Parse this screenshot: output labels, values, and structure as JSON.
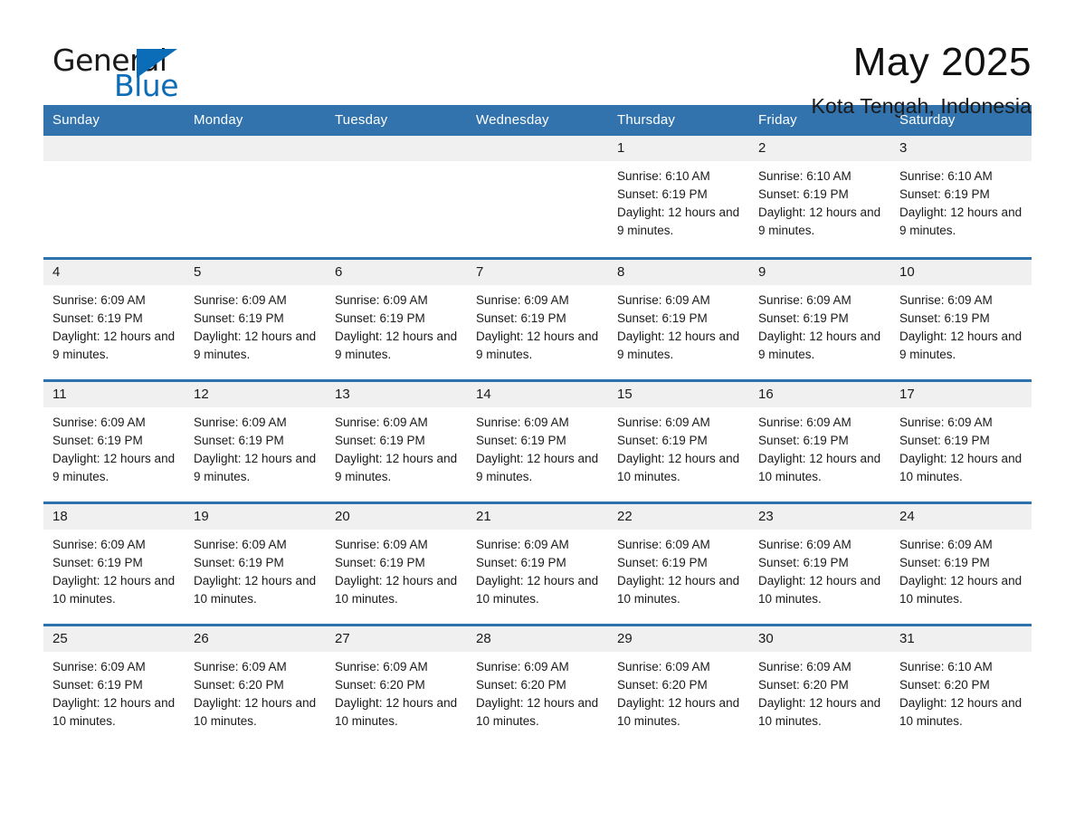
{
  "brand": {
    "name_part1": "General",
    "name_part2": "Blue",
    "triangle_color": "#0b6cb8",
    "accent_color": "#3273ad"
  },
  "header": {
    "month_title": "May 2025",
    "location": "Kota Tengah, Indonesia"
  },
  "calendar": {
    "weekday_headers": [
      "Sunday",
      "Monday",
      "Tuesday",
      "Wednesday",
      "Thursday",
      "Friday",
      "Saturday"
    ],
    "weeks": [
      [
        {
          "day": "",
          "empty": true
        },
        {
          "day": "",
          "empty": true
        },
        {
          "day": "",
          "empty": true
        },
        {
          "day": "",
          "empty": true
        },
        {
          "day": "1",
          "sunrise": "Sunrise: 6:10 AM",
          "sunset": "Sunset: 6:19 PM",
          "daylight": "Daylight: 12 hours and 9 minutes."
        },
        {
          "day": "2",
          "sunrise": "Sunrise: 6:10 AM",
          "sunset": "Sunset: 6:19 PM",
          "daylight": "Daylight: 12 hours and 9 minutes."
        },
        {
          "day": "3",
          "sunrise": "Sunrise: 6:10 AM",
          "sunset": "Sunset: 6:19 PM",
          "daylight": "Daylight: 12 hours and 9 minutes."
        }
      ],
      [
        {
          "day": "4",
          "sunrise": "Sunrise: 6:09 AM",
          "sunset": "Sunset: 6:19 PM",
          "daylight": "Daylight: 12 hours and 9 minutes."
        },
        {
          "day": "5",
          "sunrise": "Sunrise: 6:09 AM",
          "sunset": "Sunset: 6:19 PM",
          "daylight": "Daylight: 12 hours and 9 minutes."
        },
        {
          "day": "6",
          "sunrise": "Sunrise: 6:09 AM",
          "sunset": "Sunset: 6:19 PM",
          "daylight": "Daylight: 12 hours and 9 minutes."
        },
        {
          "day": "7",
          "sunrise": "Sunrise: 6:09 AM",
          "sunset": "Sunset: 6:19 PM",
          "daylight": "Daylight: 12 hours and 9 minutes."
        },
        {
          "day": "8",
          "sunrise": "Sunrise: 6:09 AM",
          "sunset": "Sunset: 6:19 PM",
          "daylight": "Daylight: 12 hours and 9 minutes."
        },
        {
          "day": "9",
          "sunrise": "Sunrise: 6:09 AM",
          "sunset": "Sunset: 6:19 PM",
          "daylight": "Daylight: 12 hours and 9 minutes."
        },
        {
          "day": "10",
          "sunrise": "Sunrise: 6:09 AM",
          "sunset": "Sunset: 6:19 PM",
          "daylight": "Daylight: 12 hours and 9 minutes."
        }
      ],
      [
        {
          "day": "11",
          "sunrise": "Sunrise: 6:09 AM",
          "sunset": "Sunset: 6:19 PM",
          "daylight": "Daylight: 12 hours and 9 minutes."
        },
        {
          "day": "12",
          "sunrise": "Sunrise: 6:09 AM",
          "sunset": "Sunset: 6:19 PM",
          "daylight": "Daylight: 12 hours and 9 minutes."
        },
        {
          "day": "13",
          "sunrise": "Sunrise: 6:09 AM",
          "sunset": "Sunset: 6:19 PM",
          "daylight": "Daylight: 12 hours and 9 minutes."
        },
        {
          "day": "14",
          "sunrise": "Sunrise: 6:09 AM",
          "sunset": "Sunset: 6:19 PM",
          "daylight": "Daylight: 12 hours and 9 minutes."
        },
        {
          "day": "15",
          "sunrise": "Sunrise: 6:09 AM",
          "sunset": "Sunset: 6:19 PM",
          "daylight": "Daylight: 12 hours and 10 minutes."
        },
        {
          "day": "16",
          "sunrise": "Sunrise: 6:09 AM",
          "sunset": "Sunset: 6:19 PM",
          "daylight": "Daylight: 12 hours and 10 minutes."
        },
        {
          "day": "17",
          "sunrise": "Sunrise: 6:09 AM",
          "sunset": "Sunset: 6:19 PM",
          "daylight": "Daylight: 12 hours and 10 minutes."
        }
      ],
      [
        {
          "day": "18",
          "sunrise": "Sunrise: 6:09 AM",
          "sunset": "Sunset: 6:19 PM",
          "daylight": "Daylight: 12 hours and 10 minutes."
        },
        {
          "day": "19",
          "sunrise": "Sunrise: 6:09 AM",
          "sunset": "Sunset: 6:19 PM",
          "daylight": "Daylight: 12 hours and 10 minutes."
        },
        {
          "day": "20",
          "sunrise": "Sunrise: 6:09 AM",
          "sunset": "Sunset: 6:19 PM",
          "daylight": "Daylight: 12 hours and 10 minutes."
        },
        {
          "day": "21",
          "sunrise": "Sunrise: 6:09 AM",
          "sunset": "Sunset: 6:19 PM",
          "daylight": "Daylight: 12 hours and 10 minutes."
        },
        {
          "day": "22",
          "sunrise": "Sunrise: 6:09 AM",
          "sunset": "Sunset: 6:19 PM",
          "daylight": "Daylight: 12 hours and 10 minutes."
        },
        {
          "day": "23",
          "sunrise": "Sunrise: 6:09 AM",
          "sunset": "Sunset: 6:19 PM",
          "daylight": "Daylight: 12 hours and 10 minutes."
        },
        {
          "day": "24",
          "sunrise": "Sunrise: 6:09 AM",
          "sunset": "Sunset: 6:19 PM",
          "daylight": "Daylight: 12 hours and 10 minutes."
        }
      ],
      [
        {
          "day": "25",
          "sunrise": "Sunrise: 6:09 AM",
          "sunset": "Sunset: 6:19 PM",
          "daylight": "Daylight: 12 hours and 10 minutes."
        },
        {
          "day": "26",
          "sunrise": "Sunrise: 6:09 AM",
          "sunset": "Sunset: 6:20 PM",
          "daylight": "Daylight: 12 hours and 10 minutes."
        },
        {
          "day": "27",
          "sunrise": "Sunrise: 6:09 AM",
          "sunset": "Sunset: 6:20 PM",
          "daylight": "Daylight: 12 hours and 10 minutes."
        },
        {
          "day": "28",
          "sunrise": "Sunrise: 6:09 AM",
          "sunset": "Sunset: 6:20 PM",
          "daylight": "Daylight: 12 hours and 10 minutes."
        },
        {
          "day": "29",
          "sunrise": "Sunrise: 6:09 AM",
          "sunset": "Sunset: 6:20 PM",
          "daylight": "Daylight: 12 hours and 10 minutes."
        },
        {
          "day": "30",
          "sunrise": "Sunrise: 6:09 AM",
          "sunset": "Sunset: 6:20 PM",
          "daylight": "Daylight: 12 hours and 10 minutes."
        },
        {
          "day": "31",
          "sunrise": "Sunrise: 6:10 AM",
          "sunset": "Sunset: 6:20 PM",
          "daylight": "Daylight: 12 hours and 10 minutes."
        }
      ]
    ]
  }
}
